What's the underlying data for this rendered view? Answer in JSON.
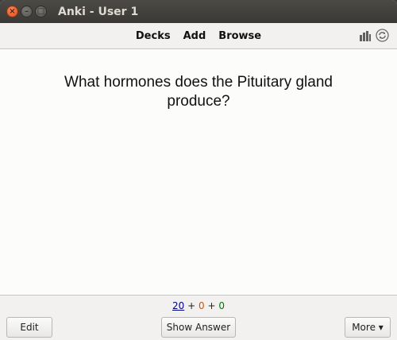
{
  "window": {
    "title": "Anki - User 1",
    "controls": {
      "close": "×",
      "minimize": "–",
      "maximize": "□"
    }
  },
  "toolbar": {
    "nav": [
      "Decks",
      "Add",
      "Browse"
    ],
    "icons": [
      "stats-icon",
      "sync-icon"
    ]
  },
  "card": {
    "question": "What hormones does the Pituitary gland produce?"
  },
  "counts": {
    "new": "20",
    "learning": "0",
    "review": "0",
    "sep": "+"
  },
  "buttons": {
    "edit": "Edit",
    "show_answer": "Show Answer",
    "more": "More ▾"
  },
  "colors": {
    "new": "#00008b",
    "learning": "#c35617",
    "review": "#007700",
    "close_button": "#df4a16"
  }
}
